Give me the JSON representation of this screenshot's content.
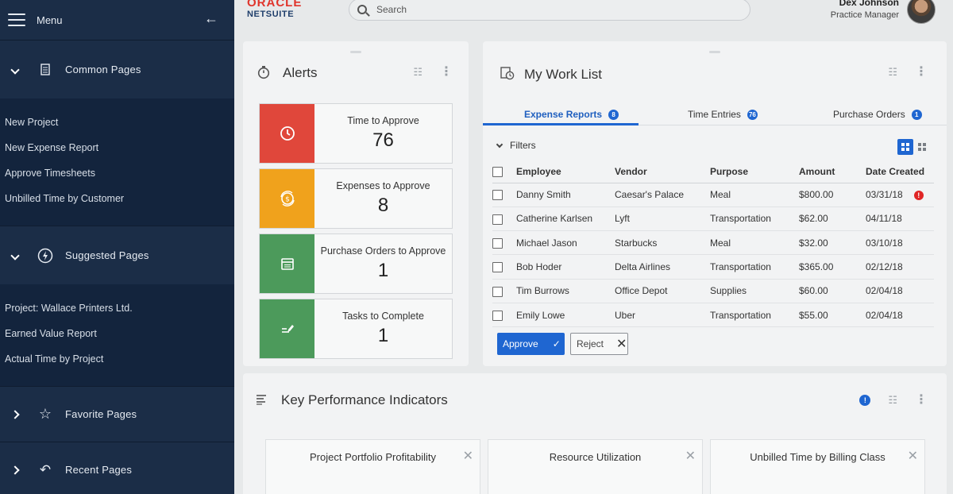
{
  "sidebar": {
    "menu_label": "Menu",
    "sections": [
      {
        "title": "Common Pages",
        "expanded": true,
        "icon": "document-icon",
        "links": [
          "New Project",
          "New Expense Report",
          "Approve Timesheets",
          "Unbilled Time by Customer"
        ]
      },
      {
        "title": "Suggested Pages",
        "expanded": true,
        "icon": "lightning-icon",
        "links": [
          "Project: Wallace Printers Ltd.",
          "Earned Value Report",
          "Actual Time by Project"
        ]
      },
      {
        "title": "Favorite Pages",
        "expanded": false,
        "icon": "star-icon",
        "links": []
      },
      {
        "title": "Recent Pages",
        "expanded": false,
        "icon": "history-icon",
        "links": []
      }
    ]
  },
  "header": {
    "logo_top": "ORACLE",
    "logo_bottom": "NETSUITE",
    "search_placeholder": "Search",
    "user_name": "Dex Johnson",
    "user_role": "Practice Manager"
  },
  "alerts": {
    "title": "Alerts",
    "items": [
      {
        "label": "Time to Approve",
        "count": "76",
        "color": "#e0473b",
        "icon": "clock-icon"
      },
      {
        "label": "Expenses to Approve",
        "count": "8",
        "color": "#f0a21c",
        "icon": "coin-icon"
      },
      {
        "label": "Purchase Orders to Approve",
        "count": "1",
        "color": "#4c9a5b",
        "icon": "calendar-icon"
      },
      {
        "label": "Tasks to Complete",
        "count": "1",
        "color": "#4c9a5b",
        "icon": "edit-icon"
      }
    ]
  },
  "worklist": {
    "title": "My Work List",
    "tabs": [
      {
        "label": "Expense Reports",
        "badge": "8"
      },
      {
        "label": "Time Entries",
        "badge": "76"
      },
      {
        "label": "Purchase Orders",
        "badge": "1"
      }
    ],
    "filters_label": "Filters",
    "columns": [
      "Employee",
      "Vendor",
      "Purpose",
      "Amount",
      "Date Created"
    ],
    "rows": [
      {
        "employee": "Danny Smith",
        "vendor": "Caesar's Palace",
        "purpose": "Meal",
        "amount": "$800.00",
        "date": "03/31/18",
        "flag": "!"
      },
      {
        "employee": "Catherine Karlsen",
        "vendor": "Lyft",
        "purpose": "Transportation",
        "amount": "$62.00",
        "date": "04/11/18"
      },
      {
        "employee": "Michael Jason",
        "vendor": "Starbucks",
        "purpose": "Meal",
        "amount": "$32.00",
        "date": "03/10/18"
      },
      {
        "employee": "Bob Hoder",
        "vendor": "Delta Airlines",
        "purpose": "Transportation",
        "amount": "$365.00",
        "date": "02/12/18"
      },
      {
        "employee": "Tim Burrows",
        "vendor": "Office Depot",
        "purpose": "Supplies",
        "amount": "$60.00",
        "date": "02/04/18"
      },
      {
        "employee": "Emily Lowe",
        "vendor": "Uber",
        "purpose": "Transportation",
        "amount": "$55.00",
        "date": "02/04/18"
      }
    ],
    "approve_label": "Approve",
    "reject_label": "Reject"
  },
  "kpi": {
    "title": "Key Performance Indicators",
    "info_badge": "!",
    "cards": [
      "Project Portfolio Profitability",
      "Resource Utilization",
      "Unbilled Time by Billing Class"
    ]
  },
  "colors": {
    "accent": "#1f66d1",
    "sidebar_bg": "#13243d",
    "danger": "#e02626"
  }
}
